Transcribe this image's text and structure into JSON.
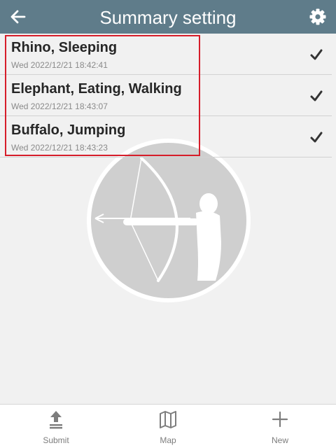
{
  "header": {
    "title": "Summary setting",
    "back_icon": "arrow-left-icon",
    "settings_icon": "gear-icon",
    "background_color": "#5f7c8a"
  },
  "list": {
    "items": [
      {
        "title": "Rhino, Sleeping",
        "timestamp": "Wed 2022/12/21 18:42:41",
        "icon": "checkmark-icon"
      },
      {
        "title": "Elephant, Eating, Walking",
        "timestamp": "Wed 2022/12/21 18:43:07",
        "icon": "checkmark-icon"
      },
      {
        "title": "Buffalo, Jumping",
        "timestamp": "Wed 2022/12/21 18:43:23",
        "icon": "checkmark-icon"
      }
    ]
  },
  "highlight_color": "#d61d2a",
  "watermark_icon": "archer-logo-icon",
  "bottom_nav": {
    "submit": {
      "label": "Submit",
      "icon": "upload-icon"
    },
    "map": {
      "label": "Map",
      "icon": "map-icon"
    },
    "new": {
      "label": "New",
      "icon": "plus-icon"
    }
  }
}
